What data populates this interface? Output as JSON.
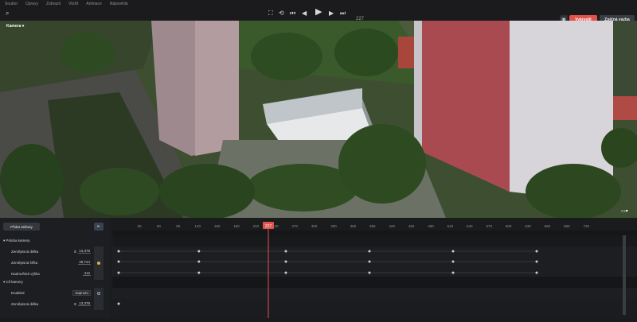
{
  "menu": [
    "Soubor",
    "Úpravy",
    "Zobrazit",
    "Vložit",
    "Animace",
    "Nápověda"
  ],
  "toolbar": {
    "frame": "227",
    "render_label": "Vykreslit",
    "feedback_label": "Zpětná vazba"
  },
  "viewport": {
    "camera_label": "Kamera"
  },
  "panel": {
    "add_attr": "Přidat atributy",
    "groups": [
      {
        "title": "Poloha kamery",
        "rows": [
          {
            "label": "Zeměpisná délka",
            "prefix": "E",
            "value": "13,378"
          },
          {
            "label": "Zeměpisná šířka",
            "prefix": "",
            "value": "49,744"
          },
          {
            "label": "Nadmořská výška",
            "prefix": "",
            "value": "412"
          }
        ]
      },
      {
        "title": "Cíl kamery",
        "rows": [
          {
            "label": "Enabled",
            "prefix": "",
            "value": "Zapnuto"
          },
          {
            "label": "Zeměpisná délka",
            "prefix": "E",
            "value": "13,378"
          }
        ]
      }
    ]
  },
  "timeline": {
    "ticks": [
      "30",
      "60",
      "90",
      "120",
      "150",
      "180",
      "210",
      "240",
      "270",
      "300",
      "330",
      "360",
      "390",
      "420",
      "450",
      "480",
      "510",
      "540",
      "570",
      "600",
      "630",
      "660",
      "690",
      "720"
    ],
    "playhead": "227",
    "playhead_color": "#e0524b",
    "keyframes": {
      "row1": [
        0,
        120,
        250,
        375,
        500,
        625
      ],
      "row2": [
        0,
        120,
        250,
        375,
        500,
        625
      ],
      "row3": [
        0,
        120,
        250,
        375,
        500,
        625
      ],
      "row5": [
        0
      ]
    }
  }
}
